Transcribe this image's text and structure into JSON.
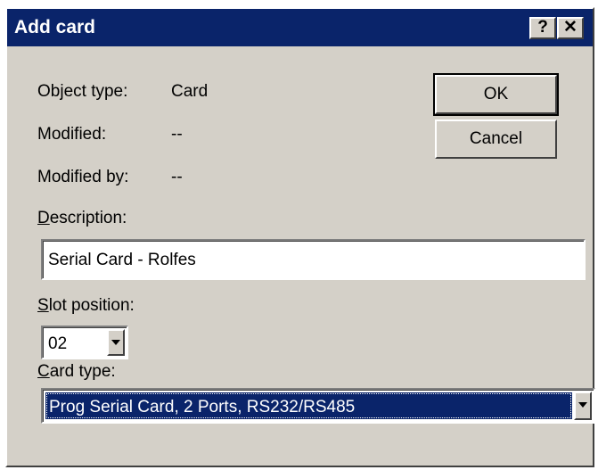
{
  "window": {
    "title": "Add card",
    "help_label": "?",
    "close_label": "✕"
  },
  "info": {
    "object_type_label": "Object type:",
    "object_type_value": "Card",
    "modified_label": "Modified:",
    "modified_value": "--",
    "modified_by_label": "Modified by:",
    "modified_by_value": "--"
  },
  "buttons": {
    "ok_label": "OK",
    "cancel_label": "Cancel"
  },
  "description": {
    "label_mnemonic": "D",
    "label_rest": "escription:",
    "value": "Serial Card - Rolfes"
  },
  "slot": {
    "label_mnemonic": "S",
    "label_rest": "lot position:",
    "selected": "02"
  },
  "card_type": {
    "label_mnemonic": "C",
    "label_rest": "ard type:",
    "selected": "Prog Serial Card, 2 Ports, RS232/RS485"
  },
  "icons": {
    "dropdown": "chevron-down-icon",
    "help": "question-mark-icon",
    "close": "close-icon"
  },
  "colors": {
    "titlebar": "#0a246a",
    "face": "#d4d0c8",
    "selection": "#0a246a"
  }
}
